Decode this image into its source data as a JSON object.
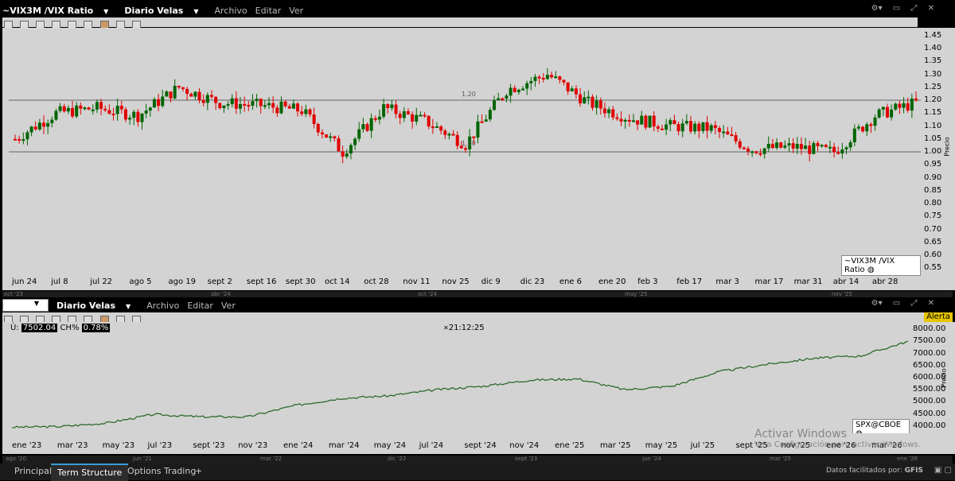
{
  "top": {
    "symbol": "~VIX3M /VIX Ratio",
    "mode": "Diario Velas",
    "menu": [
      "Archivo",
      "Editar",
      "Ver"
    ],
    "y_ticks": [
      "1.45",
      "1.40",
      "1.35",
      "1.30",
      "1.25",
      "1.20",
      "1.15",
      "1.10",
      "1.05",
      "1.00",
      "0.95",
      "0.90",
      "0.85",
      "0.80",
      "0.75",
      "0.70",
      "0.65",
      "0.60",
      "0.55"
    ],
    "y_label": "Precio",
    "x_ticks": [
      "jun 24",
      "jul 8",
      "jul 22",
      "ago 5",
      "ago 19",
      "sept 2",
      "sept 16",
      "sept 30",
      "oct 14",
      "oct 28",
      "nov 11",
      "nov 25",
      "dic 9",
      "dic 23",
      "ene 6",
      "ene 20",
      "feb 3",
      "feb 17",
      "mar 3",
      "mar 17",
      "mar 31",
      "abr 14",
      "abr 28"
    ],
    "ref_line_1": "1.20",
    "ref_line_2": "1.00",
    "legend": "~VIX3M /VIX Ratio",
    "scroll_labels": [
      "oct '23",
      "abr '24",
      "oct '24",
      "may '25",
      "nov '25"
    ]
  },
  "bottom": {
    "mode": "Diario Velas",
    "menu": [
      "Archivo",
      "Editar",
      "Ver"
    ],
    "last_label": "Ú:",
    "last_value": "7502.04",
    "ch_label": "CH%",
    "ch_value": "0.78%",
    "time": "21:12:25",
    "alert": "Alerta",
    "y_ticks": [
      "8000.00",
      "7500.00",
      "7000.00",
      "6500.00",
      "6000.00",
      "5500.00",
      "5000.00",
      "4500.00",
      "4000.00"
    ],
    "y_label": "Precio",
    "x_ticks": [
      "ene '23",
      "mar '23",
      "may '23",
      "jul '23",
      "sept '23",
      "nov '23",
      "ene '24",
      "mar '24",
      "may '24",
      "jul '24",
      "sept '24",
      "nov '24",
      "ene '25",
      "mar '25",
      "may '25",
      "jul '25",
      "sept '25",
      "nov '25",
      "ene '26",
      "mar '26"
    ],
    "legend": "SPX@CBOE",
    "scroll_labels": [
      "ago '20",
      "jun '21",
      "mar '22",
      "dic '22",
      "sept '23",
      "jun '24",
      "mar '25",
      "ene '26"
    ],
    "watermark_title": "Activar Windows",
    "watermark_sub": "Ve a Configuración para activar Windows."
  },
  "tabs": [
    "Principal",
    "Term Structure",
    "Options Trading",
    "+"
  ],
  "footer": "Datos facilitados por:",
  "footer_brand": "GFIS",
  "chart_data": [
    {
      "type": "candlestick",
      "title": "~VIX3M /VIX Ratio",
      "ylabel": "Precio",
      "ylim": [
        0.52,
        1.48
      ],
      "reference_lines": [
        1.2,
        1.0
      ],
      "x": [
        "jun 24",
        "jul 8",
        "jul 22",
        "ago 5",
        "ago 19",
        "sept 2",
        "sept 16",
        "sept 30",
        "oct 14",
        "oct 28",
        "nov 11",
        "nov 25",
        "dic 9",
        "dic 23",
        "ene 6",
        "ene 20",
        "feb 3",
        "feb 17",
        "mar 3",
        "mar 17",
        "mar 31",
        "abr 14",
        "abr 28"
      ],
      "series": [
        {
          "values": [
            1.05,
            1.15,
            1.17,
            1.14,
            1.25,
            1.19,
            1.18,
            1.16,
            1.0,
            1.17,
            1.12,
            1.03,
            1.24,
            1.3,
            1.19,
            1.13,
            1.1,
            1.09,
            1.01,
            1.02,
            1.0,
            1.14,
            1.19
          ]
        }
      ],
      "colors": {
        "up": "#006400",
        "down": "#e00000"
      }
    },
    {
      "type": "line",
      "title": "SPX@CBOE",
      "ylabel": "Precio",
      "ylim": [
        3700,
        8300
      ],
      "x": [
        "ene '23",
        "mar '23",
        "may '23",
        "jul '23",
        "sept '23",
        "nov '23",
        "ene '24",
        "mar '24",
        "may '24",
        "jul '24",
        "sept '24",
        "nov '24",
        "ene '25",
        "mar '25",
        "may '25",
        "jul '25",
        "sept '25",
        "nov '25",
        "ene '26",
        "mar '26"
      ],
      "series": [
        {
          "values": [
            3950,
            3980,
            4120,
            4480,
            4380,
            4380,
            4850,
            5150,
            5250,
            5500,
            5650,
            5900,
            5950,
            5500,
            5650,
            6250,
            6550,
            6800,
            6900,
            7500
          ]
        }
      ],
      "color": "#2e6b2e"
    }
  ]
}
